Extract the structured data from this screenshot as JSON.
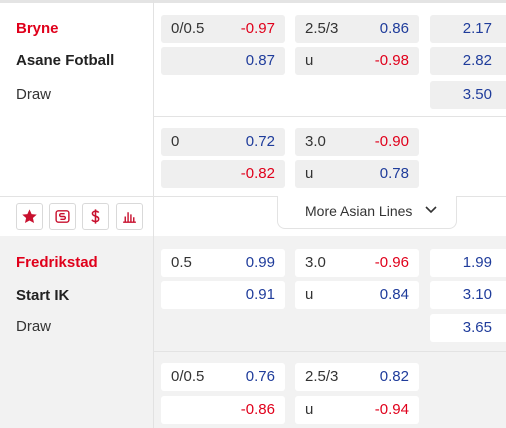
{
  "matches": [
    {
      "home": "Bryne",
      "away": "Asane Fotball",
      "draw": "Draw",
      "lines": [
        {
          "ah_line": "0/0.5",
          "ah_home": "-0.97",
          "ah_away": "0.87",
          "ou_line": "2.5/3",
          "ou_over": "0.86",
          "ou_under_label": "u",
          "ou_under": "-0.98"
        },
        {
          "ah_line": "0",
          "ah_home": "0.72",
          "ah_away": "-0.82",
          "ou_line": "3.0",
          "ou_over": "-0.90",
          "ou_under_label": "u",
          "ou_under": "0.78"
        }
      ],
      "x12": {
        "home": "2.17",
        "away": "2.82",
        "draw": "3.50"
      },
      "more_lines_label": "More Asian Lines"
    },
    {
      "home": "Fredrikstad",
      "away": "Start IK",
      "draw": "Draw",
      "lines": [
        {
          "ah_line": "0.5",
          "ah_home": "0.99",
          "ah_away": "0.91",
          "ou_line": "3.0",
          "ou_over": "-0.96",
          "ou_under_label": "u",
          "ou_under": "0.84"
        },
        {
          "ah_line": "0/0.5",
          "ah_home": "0.76",
          "ah_away": "-0.86",
          "ou_line": "2.5/3",
          "ou_over": "0.82",
          "ou_under_label": "u",
          "ou_under": "-0.94"
        }
      ],
      "x12": {
        "home": "1.99",
        "away": "3.10",
        "draw": "3.65"
      }
    }
  ],
  "icons": [
    "star-icon",
    "scoreboard-icon",
    "dollar-icon",
    "stats-icon",
    "chevron-down-icon"
  ],
  "colors": {
    "home_team": "#e0001b",
    "positive_odds": "#1f3c9b",
    "negative_odds": "#e0001b",
    "favorite_accent": "#c8102e"
  }
}
